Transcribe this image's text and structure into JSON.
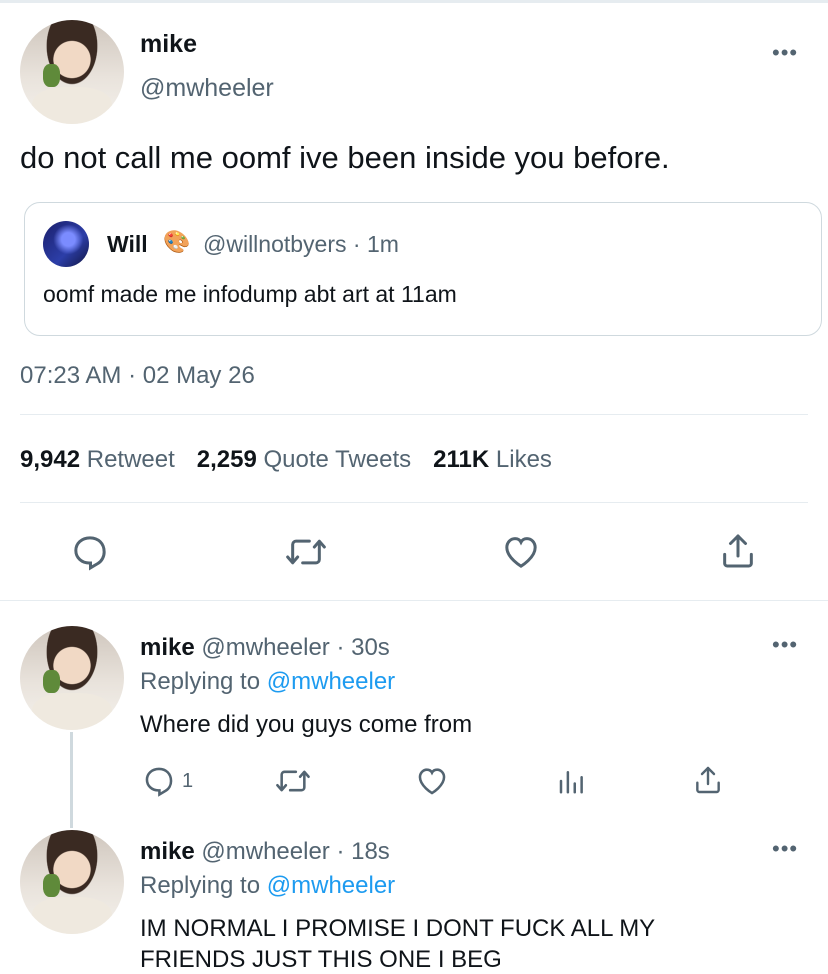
{
  "main_tweet": {
    "name": "mike",
    "handle": "@mwheeler",
    "more": "•••",
    "text": "do not call me oomf ive been inside you before.",
    "quote": {
      "name": "Will",
      "emoji": "🎨",
      "handle_time": "@willnotbyers · 1m",
      "text": "oomf made me infodump abt art at 11am"
    },
    "timestamp": "07:23 AM · 02 May 26",
    "stats": {
      "retweets_count": "9,942",
      "retweets_label": "Retweet",
      "quotes_count": "2,259",
      "quotes_label": "Quote Tweets",
      "likes_count": "211K",
      "likes_label": "Likes"
    }
  },
  "replies": [
    {
      "name": "mike",
      "handle_time": "@mwheeler · 30s",
      "replying_to_label": "Replying to",
      "replying_to_handle": "@mwheeler",
      "text": "Where did you guys come from",
      "reply_count": "1",
      "more": "•••"
    },
    {
      "name": "mike",
      "handle_time": "@mwheeler · 18s",
      "replying_to_label": "Replying to",
      "replying_to_handle": "@mwheeler",
      "text": "IM NORMAL I PROMISE I DONT FUCK ALL MY",
      "text_line2": "FRIENDS JUST THIS ONE I BEG",
      "more": "•••"
    }
  ],
  "colors": {
    "accent": "#1d9bf0",
    "muted": "#536471",
    "divider": "#e6ecf0"
  },
  "icons": [
    "reply-icon",
    "retweet-icon",
    "like-icon",
    "share-icon",
    "analytics-icon",
    "more-icon"
  ]
}
